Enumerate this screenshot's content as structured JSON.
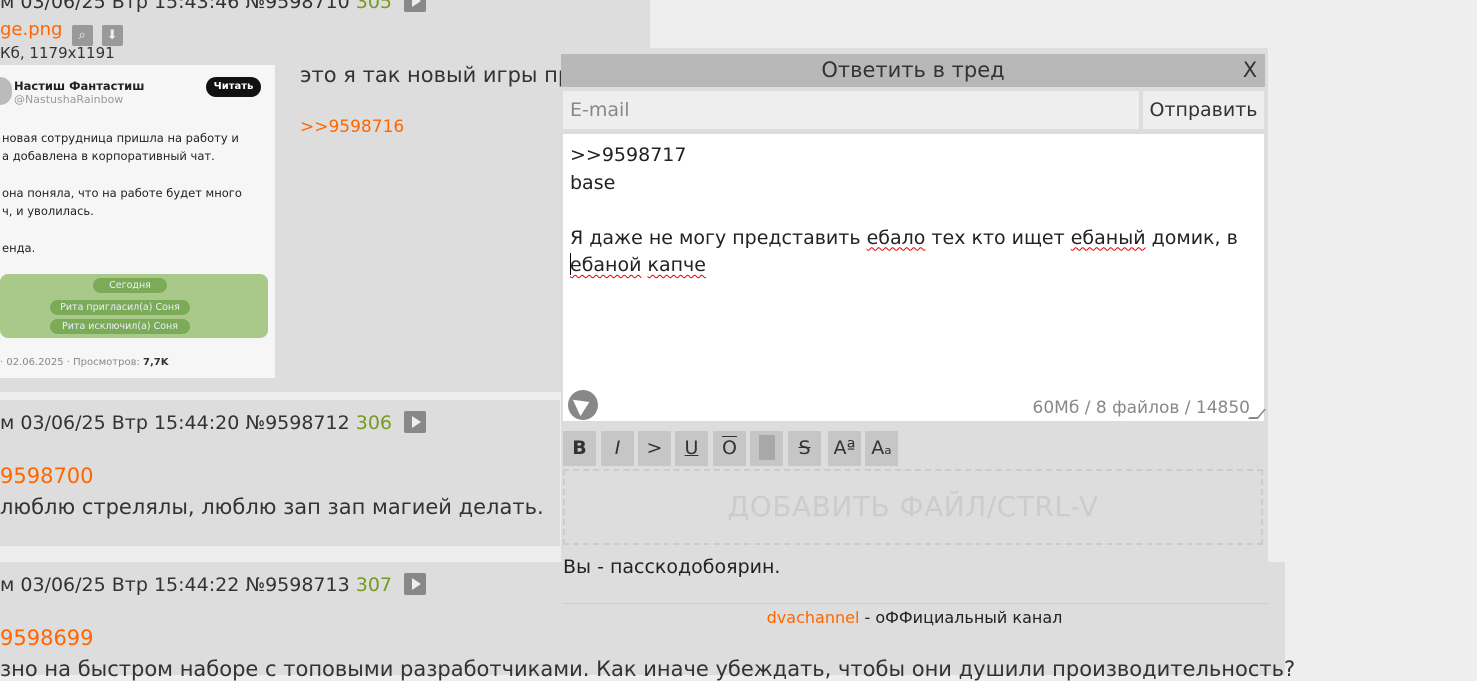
{
  "thread": {
    "post_top": {
      "header_visible": "м 03/06/25 Втр 15:43:46 №9598710",
      "num": "305",
      "file_name": "ge.png",
      "file_info": "Кб, 1179x1191",
      "text": "это я так новый игры пр",
      "reply_link": ">>9598716"
    },
    "tweet_image": {
      "name": "Настиш Фантастиш",
      "handle": "@NastushaRainbow",
      "follow": "Читать",
      "lines": [
        "новая сотрудница пришла на работу и",
        "а добавлена в корпоративный чат.",
        "она поняла, что на работе будет много",
        "ч, и уволилась.",
        "енда."
      ],
      "chat_today": "Сегодня",
      "chat_line1": "Рита пригласил(а) Соня",
      "chat_line2": "Рита исключил(а) Соня",
      "footer_date": "· 02.06.2025 · Просмотров:",
      "footer_views": "7,7K"
    },
    "post_306": {
      "header": "м  03/06/25 Втр 15:44:20 №9598712",
      "num": "306",
      "reply_link": "9598700",
      "text": "люблю стрелялы, люблю зап зап магией делать."
    },
    "post_307": {
      "header": "м  03/06/25 Втр 15:44:22 №9598713",
      "num": "307",
      "reply_link": "9598699",
      "text": "зно на быстром наборе с топовыми разработчиками. Как иначе убеждать, чтобы они душили производительность?"
    }
  },
  "reply_form": {
    "title": "Ответить в тред",
    "close": "X",
    "email_placeholder": "E-mail",
    "send_label": "Отправить",
    "comment": {
      "line1": ">>9598717",
      "line2": "base",
      "line3_a": "Я даже не могу представить ",
      "line3_b": "ебало",
      "line3_c": " тех кто ищет ",
      "line3_d": "ебаный",
      "line3_e": " домик, в",
      "line4_a": "ебаной",
      "line4_b": " ",
      "line4_c": "капче"
    },
    "limits": "60Мб / 8 файлов / 14850",
    "markup_buttons": [
      "B",
      "I",
      ">",
      "U",
      "O",
      "",
      "S",
      "Aª",
      "Aₐ"
    ],
    "dropzone_label": "ДОБАВИТЬ ФАЙЛ/CTRL-V",
    "user_status": "Вы - пасскодобоярин.",
    "channel_link": "dvachannel",
    "channel_suffix": " - оФФициальный канал"
  },
  "colors": {
    "link": "#ff6600",
    "postnum": "#789922",
    "panel": "#dddddd"
  },
  "icons": [
    "search-icon",
    "download-icon",
    "play-icon",
    "sail-icon"
  ]
}
